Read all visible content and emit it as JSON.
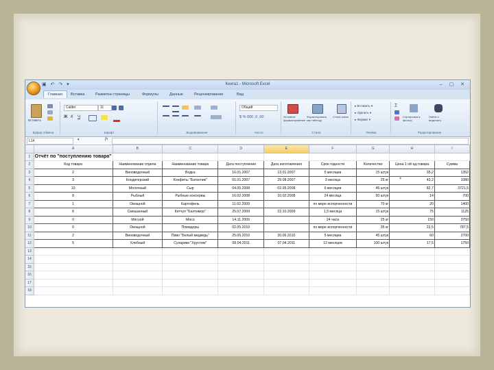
{
  "window": {
    "title": "Книга1 - Microsoft Excel",
    "qat": "▣ ↶ ↷ ▾",
    "controls": "– ▢ ✕"
  },
  "tabs": [
    "Главная",
    "Вставка",
    "Разметка страницы",
    "Формулы",
    "Данные",
    "Рецензирование",
    "Вид"
  ],
  "ribbon": {
    "paste_label": "Вставить",
    "font_name": "Calibri",
    "font_size": "11",
    "number_format": "Общий",
    "conditional_format": "Условное форматирование",
    "format_table": "Форматировать как таблицу",
    "cell_styles": "Стили ячеек",
    "insert": "Вставить",
    "delete": "Удалить",
    "format": "Формат",
    "sort": "Сортировка и фильтр",
    "find": "Найти и выделить",
    "groups": [
      "Буфер обмена",
      "Шрифт",
      "Выравнивание",
      "Число",
      "Стили",
      "Ячейки",
      "Редактирование"
    ]
  },
  "formula_bar": {
    "name_box": "L14",
    "fx": "fx",
    "content": ""
  },
  "columns": [
    "A",
    "B",
    "C",
    "D",
    "E",
    "F",
    "G",
    "H",
    "I"
  ],
  "selected_column": "E",
  "title_text": "Отчёт по \"поступлению товара\"",
  "headers": [
    "Код товара",
    "Наименование отдела",
    "Наименование товара",
    "Дата поступления",
    "Дата изготовления",
    "Срок годности",
    "Количество",
    "Цена 1 ой ед.товара",
    "Сумма"
  ],
  "rows": [
    [
      "2",
      "Виноводочный",
      "Водка",
      "16.01.2007",
      "13.01.2007",
      "5 месяцев",
      "15 штук",
      "35,2",
      "1352"
    ],
    [
      "3",
      "Кондитерский",
      "Конфеты \"Батончик\"",
      "01.01.2007",
      "29.08.2007",
      "3 месяца",
      "25 кг",
      "43,2",
      "1080"
    ],
    [
      "10",
      "Молочный",
      "Сыр",
      "04.05.2008",
      "02.05.2008",
      "6 месяцев",
      "45 штук",
      "82,7",
      "3721,5"
    ],
    [
      "8",
      "Рыбный",
      "Рыбные консервы",
      "16.02.2008",
      "10.02.2008",
      "24 месяца",
      "50 штук",
      "14",
      "700"
    ],
    [
      "1",
      "Овощной",
      "Картофель",
      "11.02.2009",
      "",
      "по мере испорченности",
      "70 кг",
      "20",
      "1400"
    ],
    [
      "6",
      "Смешанный",
      "Кетчуп \"Балтимор\"",
      "25.07.2009",
      "22.10.2009",
      "1,5 месяца",
      "15 штук",
      "75",
      "1125"
    ],
    [
      "0",
      "Мясной",
      "Мясо",
      "14.11.2009",
      "",
      "24 часа",
      "25 кг",
      "150",
      "3750"
    ],
    [
      "0",
      "Овощной",
      "Помидоры",
      "02.05.2010",
      "",
      "по мере испорченности",
      "35 кг",
      "22,5",
      "787,5"
    ],
    [
      "2",
      "Виноводочный",
      "Пиво \"Белый медведь\"",
      "25.06.2010",
      "20.06.2010",
      "5 месяцев",
      "45 штук",
      "60",
      "2700"
    ],
    [
      "5",
      "Хлебный",
      "Сухарики \"Хрустим\"",
      "08.04.2011",
      "07.04.2011",
      "12 месяцев",
      "100 штук",
      "17,5",
      "1750"
    ]
  ],
  "row_numbers": [
    "1",
    "2",
    "3",
    "4",
    "5",
    "6",
    "7",
    "8",
    "9",
    "10",
    "11",
    "12",
    "13",
    "14",
    "15",
    "16",
    "17",
    "18"
  ]
}
